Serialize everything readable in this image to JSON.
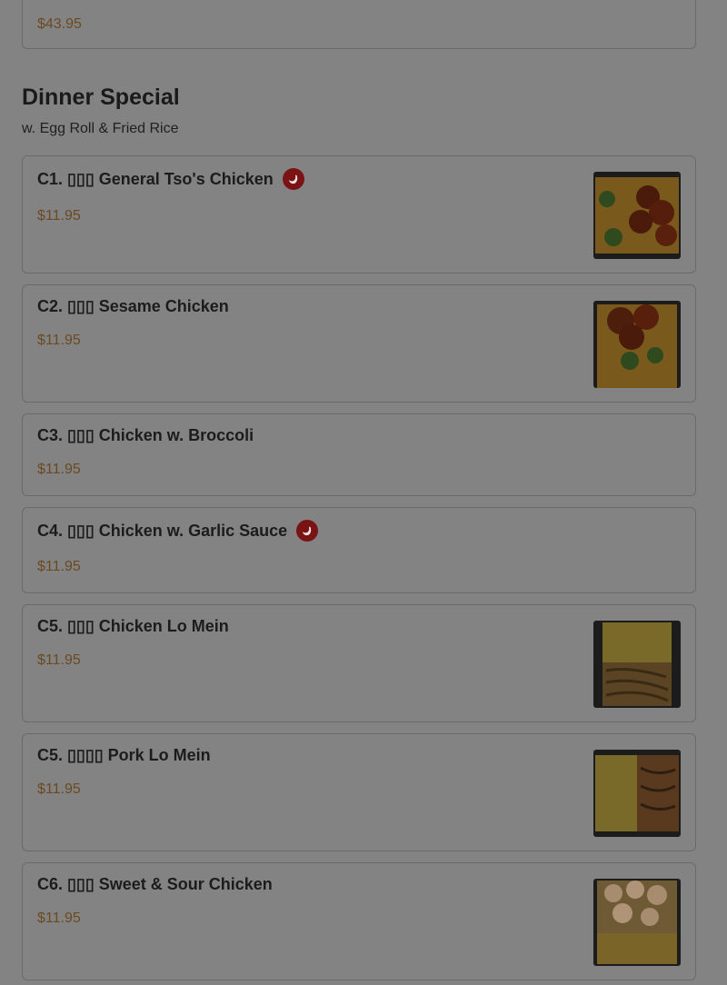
{
  "prev_card": {
    "price": "$43.95"
  },
  "section": {
    "title": "Dinner Special",
    "subtitle": "w. Egg Roll & Fried Rice"
  },
  "items": [
    {
      "name": "C1. ▯▯▯ General Tso's Chicken",
      "price": "$11.95",
      "spicy": true,
      "image": "general-tso-chicken-photo"
    },
    {
      "name": "C2. ▯▯▯ Sesame Chicken",
      "price": "$11.95",
      "spicy": false,
      "image": "sesame-chicken-photo"
    },
    {
      "name": "C3. ▯▯▯ Chicken w. Broccoli",
      "price": "$11.95",
      "spicy": false,
      "image": null
    },
    {
      "name": "C4. ▯▯▯ Chicken w. Garlic Sauce",
      "price": "$11.95",
      "spicy": true,
      "image": null
    },
    {
      "name": "C5. ▯▯▯ Chicken Lo Mein",
      "price": "$11.95",
      "spicy": false,
      "image": "chicken-lo-mein-photo"
    },
    {
      "name": "C5. ▯▯▯▯ Pork Lo Mein",
      "price": "$11.95",
      "spicy": false,
      "image": "pork-lo-mein-photo"
    },
    {
      "name": "C6. ▯▯▯ Sweet & Sour Chicken",
      "price": "$11.95",
      "spicy": false,
      "image": "sweet-sour-chicken-photo"
    }
  ],
  "colors": {
    "overlay_bg": "#838383",
    "price": "#6b4a22",
    "spicy_badge": "#7a1414"
  }
}
